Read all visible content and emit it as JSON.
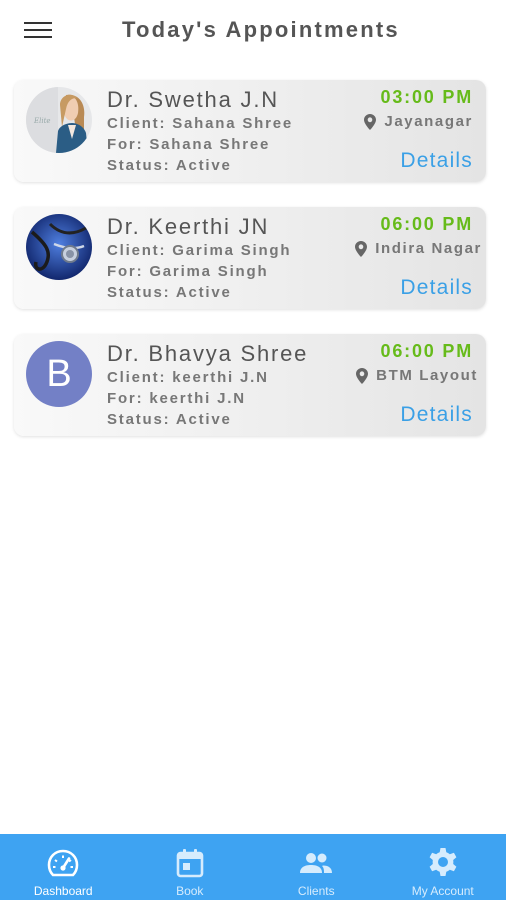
{
  "header": {
    "title": "Today's Appointments",
    "menu_icon": "hamburger-menu-icon"
  },
  "appointments": [
    {
      "doctor": "Dr. Swetha J.N",
      "client": "Client: Sahana Shree",
      "for": "For: Sahana Shree",
      "status": "Status: Active",
      "time": "03:00 PM",
      "location": "Jayanagar",
      "details_label": "Details",
      "avatar_type": "photo-woman"
    },
    {
      "doctor": "Dr. Keerthi JN",
      "client": "Client: Garima Singh",
      "for": "For: Garima Singh",
      "status": "Status: Active",
      "time": "06:00 PM",
      "location": "Indira Nagar",
      "details_label": "Details",
      "avatar_type": "photo-stethoscope"
    },
    {
      "doctor": "Dr. Bhavya Shree",
      "client": "Client: keerthi J.N",
      "for": "For: keerthi J.N",
      "status": "Status: Active",
      "time": "06:00 PM",
      "location": "BTM Layout",
      "details_label": "Details",
      "avatar_letter": "B"
    }
  ],
  "bottom_nav": {
    "items": [
      {
        "label": "Dashboard",
        "icon": "speedometer-icon",
        "active": true
      },
      {
        "label": "Book",
        "icon": "calendar-icon",
        "active": false
      },
      {
        "label": "Clients",
        "icon": "people-icon",
        "active": false
      },
      {
        "label": "My Account",
        "icon": "gear-icon",
        "active": false
      }
    ]
  },
  "colors": {
    "time_green": "#66bb1a",
    "details_blue": "#3aa0e6",
    "nav_blue": "#3ea3f2",
    "avatar_letter_bg": "#7380c6"
  }
}
